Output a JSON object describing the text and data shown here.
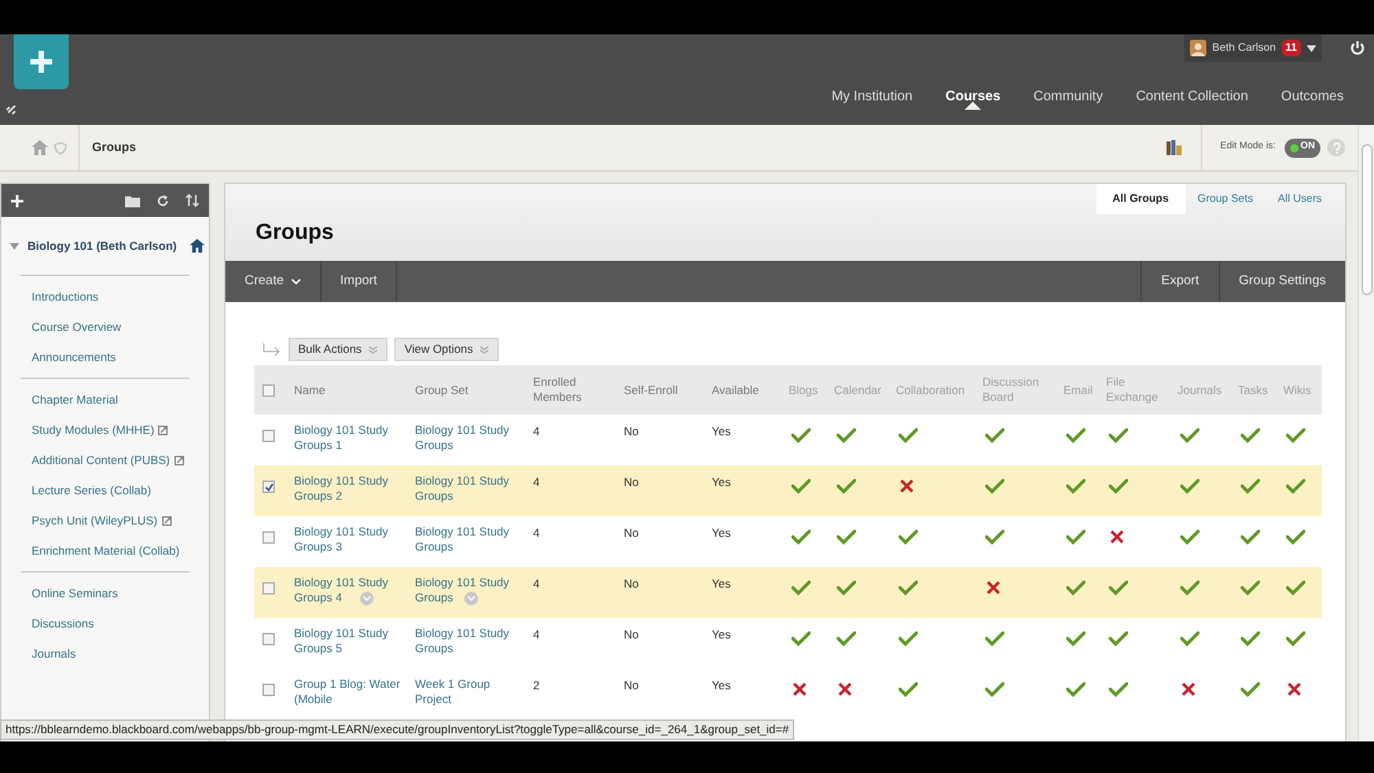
{
  "header": {
    "user": "Beth Carlson",
    "notification_count": "11",
    "nav": [
      {
        "label": "My Institution",
        "selected": false
      },
      {
        "label": "Courses",
        "selected": true
      },
      {
        "label": "Community",
        "selected": false
      },
      {
        "label": "Content Collection",
        "selected": false
      },
      {
        "label": "Outcomes",
        "selected": false
      }
    ]
  },
  "breadcrumb": {
    "page": "Groups",
    "edit_mode_label": "Edit Mode is:",
    "edit_mode": {
      "label": "ON",
      "on": true
    }
  },
  "sidebar": {
    "course_title": "Biology 101 (Beth Carlson)",
    "sections": [
      [
        {
          "label": "Introductions",
          "external": false
        },
        {
          "label": "Course Overview",
          "external": false
        },
        {
          "label": "Announcements",
          "external": false
        }
      ],
      [
        {
          "label": "Chapter Material",
          "external": false
        },
        {
          "label": "Study Modules (MHHE)",
          "external": true
        },
        {
          "label": "Additional Content (PUBS)",
          "external": true
        },
        {
          "label": "Lecture Series (Collab)",
          "external": false
        },
        {
          "label": "Psych Unit (WileyPLUS)",
          "external": true
        },
        {
          "label": "Enrichment Material (Collab)",
          "external": false
        }
      ],
      [
        {
          "label": "Online Seminars",
          "external": false
        },
        {
          "label": "Discussions",
          "external": false
        },
        {
          "label": "Journals",
          "external": false
        }
      ]
    ]
  },
  "main": {
    "tabs": [
      {
        "label": "All Groups",
        "selected": true
      },
      {
        "label": "Group Sets",
        "selected": false
      },
      {
        "label": "All Users",
        "selected": false
      }
    ],
    "title": "Groups",
    "actions_left": [
      {
        "label": "Create",
        "dropdown": true
      },
      {
        "label": "Import",
        "dropdown": false
      }
    ],
    "actions_right": [
      {
        "label": "Export",
        "dropdown": false
      },
      {
        "label": "Group Settings",
        "dropdown": false
      }
    ],
    "list_buttons": [
      "Bulk Actions",
      "View Options"
    ]
  },
  "table": {
    "select_all_checked": false,
    "columns": [
      "Name",
      "Group Set",
      "Enrolled Members",
      "Self-Enroll",
      "Available",
      "Blogs",
      "Calendar",
      "Collaboration",
      "Discussion Board",
      "Email",
      "File Exchange",
      "Journals",
      "Tasks",
      "Wikis"
    ],
    "rows": [
      {
        "checked": false,
        "hovered": false,
        "name": "Biology 101 Study Groups 1",
        "group_set": "Biology 101 Study Groups",
        "enrolled": "4",
        "self_enroll": "No",
        "available": "Yes",
        "tools": [
          true,
          true,
          true,
          true,
          true,
          true,
          true,
          true,
          true
        ]
      },
      {
        "checked": true,
        "hovered": false,
        "name": "Biology 101 Study Groups 2",
        "group_set": "Biology 101 Study Groups",
        "enrolled": "4",
        "self_enroll": "No",
        "available": "Yes",
        "tools": [
          true,
          true,
          false,
          true,
          true,
          true,
          true,
          true,
          true
        ]
      },
      {
        "checked": false,
        "hovered": false,
        "name": "Biology 101 Study Groups 3",
        "group_set": "Biology 101 Study Groups",
        "enrolled": "4",
        "self_enroll": "No",
        "available": "Yes",
        "tools": [
          true,
          true,
          true,
          true,
          true,
          false,
          true,
          true,
          true
        ]
      },
      {
        "checked": false,
        "hovered": true,
        "name": "Biology 101 Study Groups 4",
        "group_set": "Biology 101 Study Groups",
        "enrolled": "4",
        "self_enroll": "No",
        "available": "Yes",
        "tools": [
          true,
          true,
          true,
          false,
          true,
          true,
          true,
          true,
          true
        ]
      },
      {
        "checked": false,
        "hovered": false,
        "name": "Biology 101 Study Groups 5",
        "group_set": "Biology 101 Study Groups",
        "enrolled": "4",
        "self_enroll": "No",
        "available": "Yes",
        "tools": [
          true,
          true,
          true,
          true,
          true,
          true,
          true,
          true,
          true
        ]
      },
      {
        "checked": false,
        "hovered": false,
        "name": "Group 1 Blog: Water (Mobile",
        "group_set": "Week 1 Group Project",
        "enrolled": "2",
        "self_enroll": "No",
        "available": "Yes",
        "tools": [
          false,
          false,
          true,
          true,
          true,
          true,
          false,
          true,
          false
        ]
      }
    ]
  },
  "status_bar": "https://bblearndemo.blackboard.com/webapps/bb-group-mgmt-LEARN/execute/groupInventoryList?toggleType=all&course_id=_264_1&group_set_id=#"
}
